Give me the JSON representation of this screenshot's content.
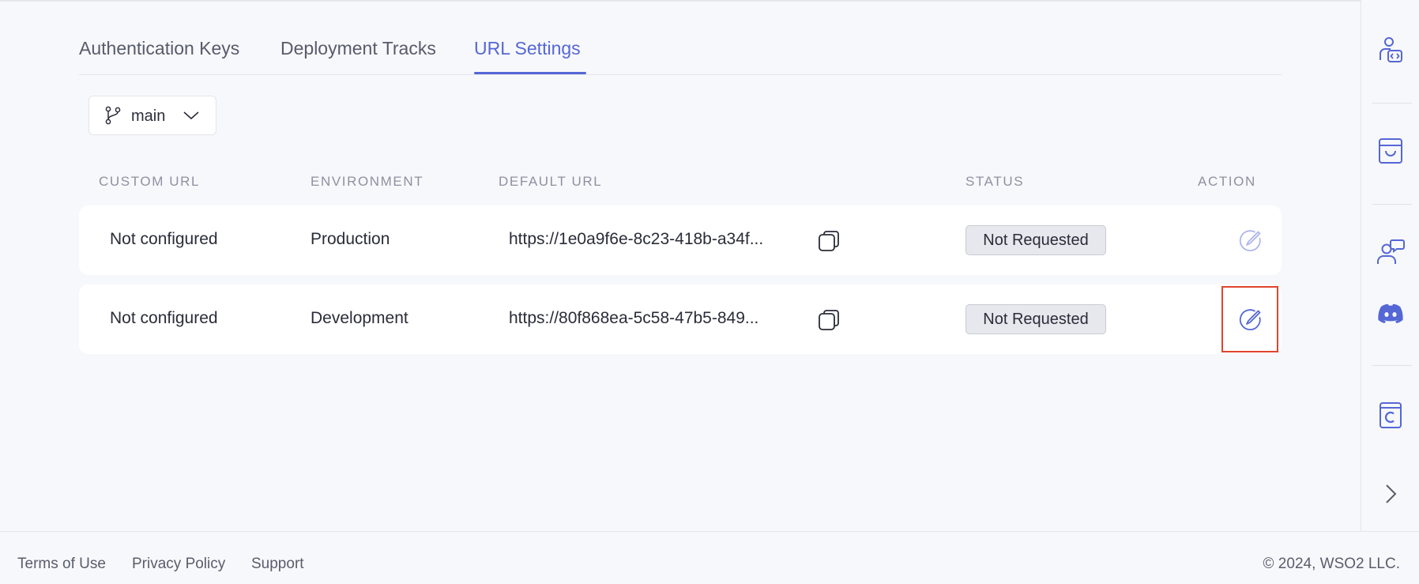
{
  "tabs": [
    {
      "label": "Authentication Keys",
      "active": false
    },
    {
      "label": "Deployment Tracks",
      "active": false
    },
    {
      "label": "URL Settings",
      "active": true
    }
  ],
  "branch": {
    "label": "main",
    "icon": "git-branch-icon"
  },
  "table": {
    "headers": [
      "CUSTOM URL",
      "ENVIRONMENT",
      "DEFAULT URL",
      "STATUS",
      "ACTION"
    ],
    "rows": [
      {
        "custom_url": "Not configured",
        "environment": "Production",
        "default_url": "https://1e0a9f6e-8c23-418b-a34f...",
        "status": "Not Requested"
      },
      {
        "custom_url": "Not configured",
        "environment": "Development",
        "default_url": "https://80f868ea-5c58-47b5-849...",
        "status": "Not Requested"
      }
    ]
  },
  "rail_icons": [
    "developer-portal-icon",
    "marketplace-icon",
    "support-chat-icon",
    "discord-icon",
    "console-icon",
    "chevron-right-icon"
  ],
  "footer": {
    "links": [
      "Terms of Use",
      "Privacy Policy",
      "Support"
    ],
    "copyright": "© 2024, WSO2 LLC."
  },
  "colors": {
    "accent": "#5567d5",
    "highlight": "#e0442f",
    "background": "#f7f8fb"
  }
}
